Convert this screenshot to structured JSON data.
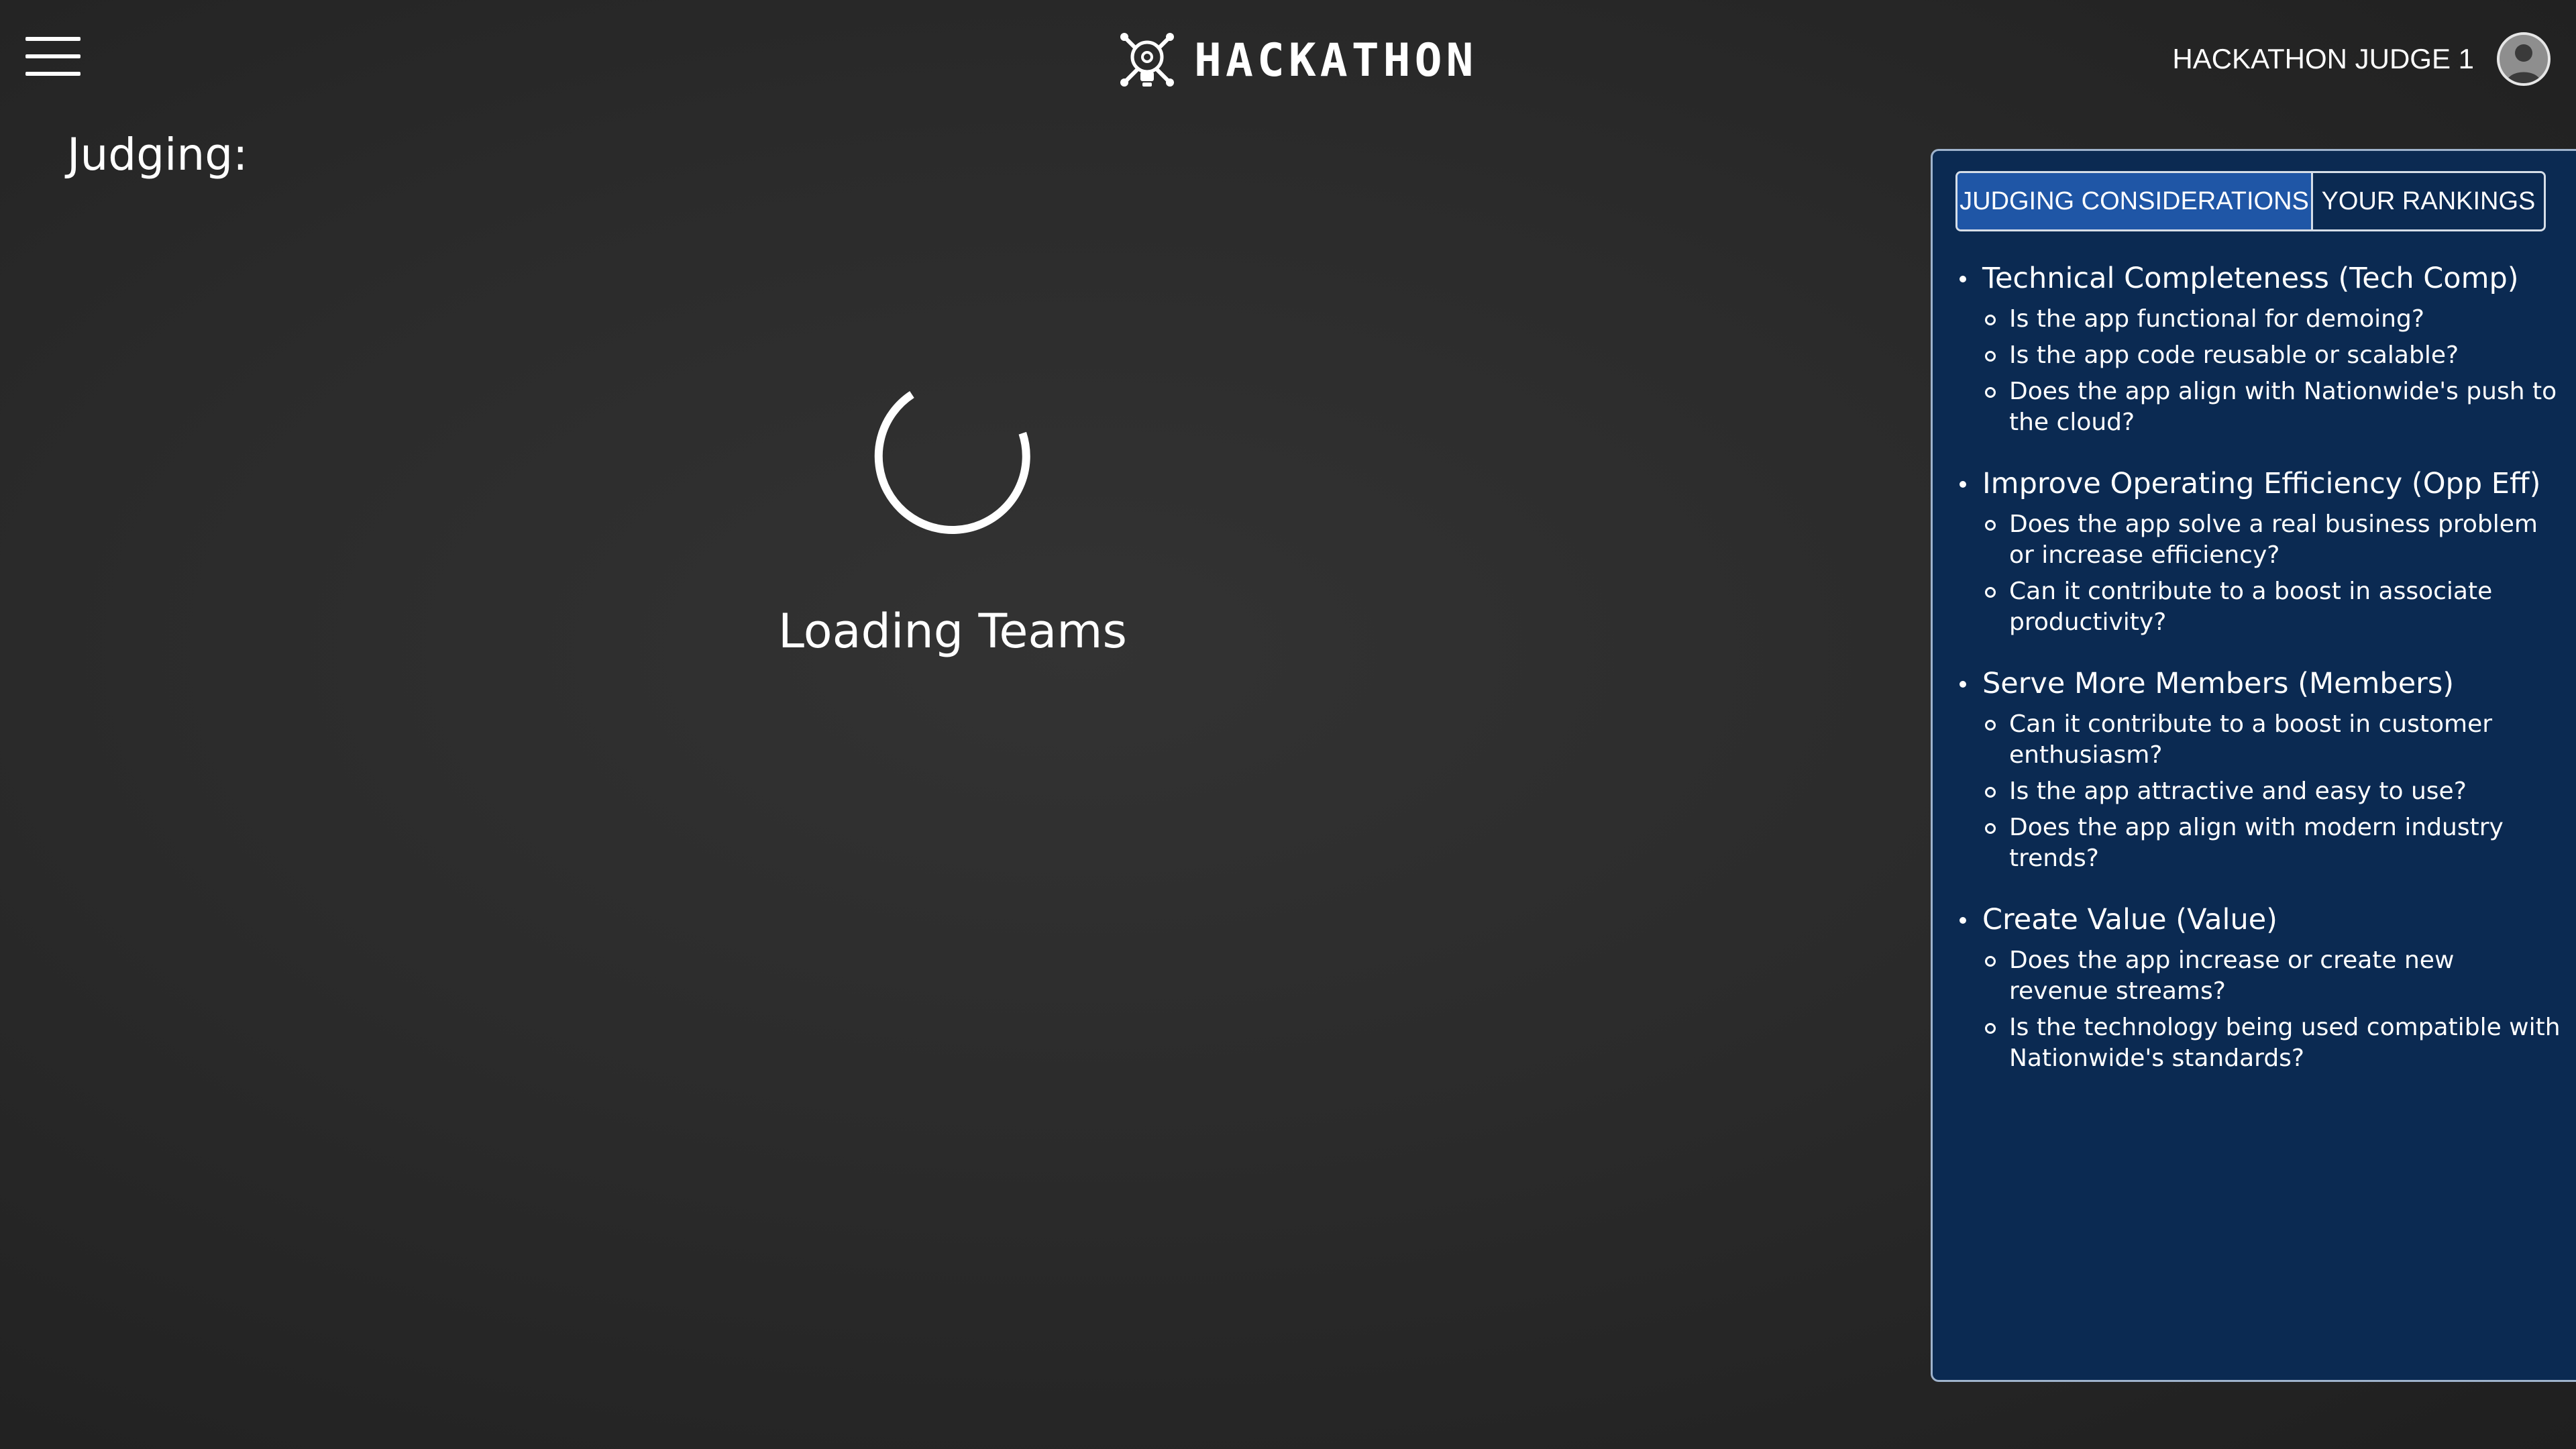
{
  "header": {
    "logo_text": "HACKATHON",
    "user_name": "HACKATHON JUDGE 1"
  },
  "page": {
    "title": "Judging:",
    "loading_text": "Loading Teams"
  },
  "panel": {
    "tabs": [
      {
        "label": "JUDGING CONSIDERATIONS",
        "active": true
      },
      {
        "label": "YOUR RANKINGS",
        "active": false
      }
    ],
    "criteria": [
      {
        "title": "Technical Completeness (Tech Comp)",
        "questions": [
          "Is the app functional for demoing?",
          "Is the app code reusable or scalable?",
          "Does the app align with Nationwide's push to the cloud?"
        ]
      },
      {
        "title": "Improve Operating Efficiency (Opp Eff)",
        "questions": [
          "Does the app solve a real business problem or increase efficiency?",
          "Can it contribute to a boost in associate productivity?"
        ]
      },
      {
        "title": "Serve More Members (Members)",
        "questions": [
          "Can it contribute to a boost in customer enthusiasm?",
          "Is the app attractive and easy to use?",
          "Does the app align with modern industry trends?"
        ]
      },
      {
        "title": "Create Value (Value)",
        "questions": [
          "Does the app increase or create new revenue streams?",
          "Is the technology being used compatible with Nationwide's standards?"
        ]
      }
    ]
  },
  "colors": {
    "panel_bg": "#0b2a52",
    "active_tab": "#1f56a6",
    "page_bg": "#2b2b2b"
  }
}
